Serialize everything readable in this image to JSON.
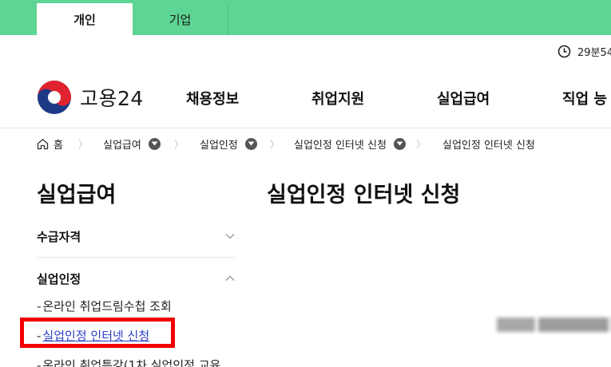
{
  "tabs": [
    {
      "label": "개인",
      "active": true
    },
    {
      "label": "기업",
      "active": false
    }
  ],
  "timer": {
    "text": "29분54"
  },
  "logo": {
    "text": "고용24"
  },
  "nav": [
    "채용정보",
    "취업지원",
    "실업급여",
    "직업 능"
  ],
  "breadcrumb": {
    "home": "홈",
    "items": [
      "실업급여",
      "실업인정",
      "실업인정 인터넷 신청",
      "실업인정 인터넷 신청"
    ]
  },
  "sidebar": {
    "title": "실업급여",
    "sections": [
      {
        "label": "수급자격",
        "expanded": false
      },
      {
        "label": "실업인정",
        "expanded": true
      }
    ],
    "subitems": [
      {
        "label": "온라인 취업드림수첩 조회",
        "active": false
      },
      {
        "label": "실업인정 인터넷 신청",
        "active": true
      },
      {
        "label": "온라인 취업특강(1차 실업인정 교육",
        "active": false
      }
    ]
  },
  "main": {
    "title": "실업인정 인터넷 신청"
  },
  "colors": {
    "brand_green": "#5ed592",
    "link_blue": "#2a3fc7",
    "highlight_red": "#f20000"
  }
}
